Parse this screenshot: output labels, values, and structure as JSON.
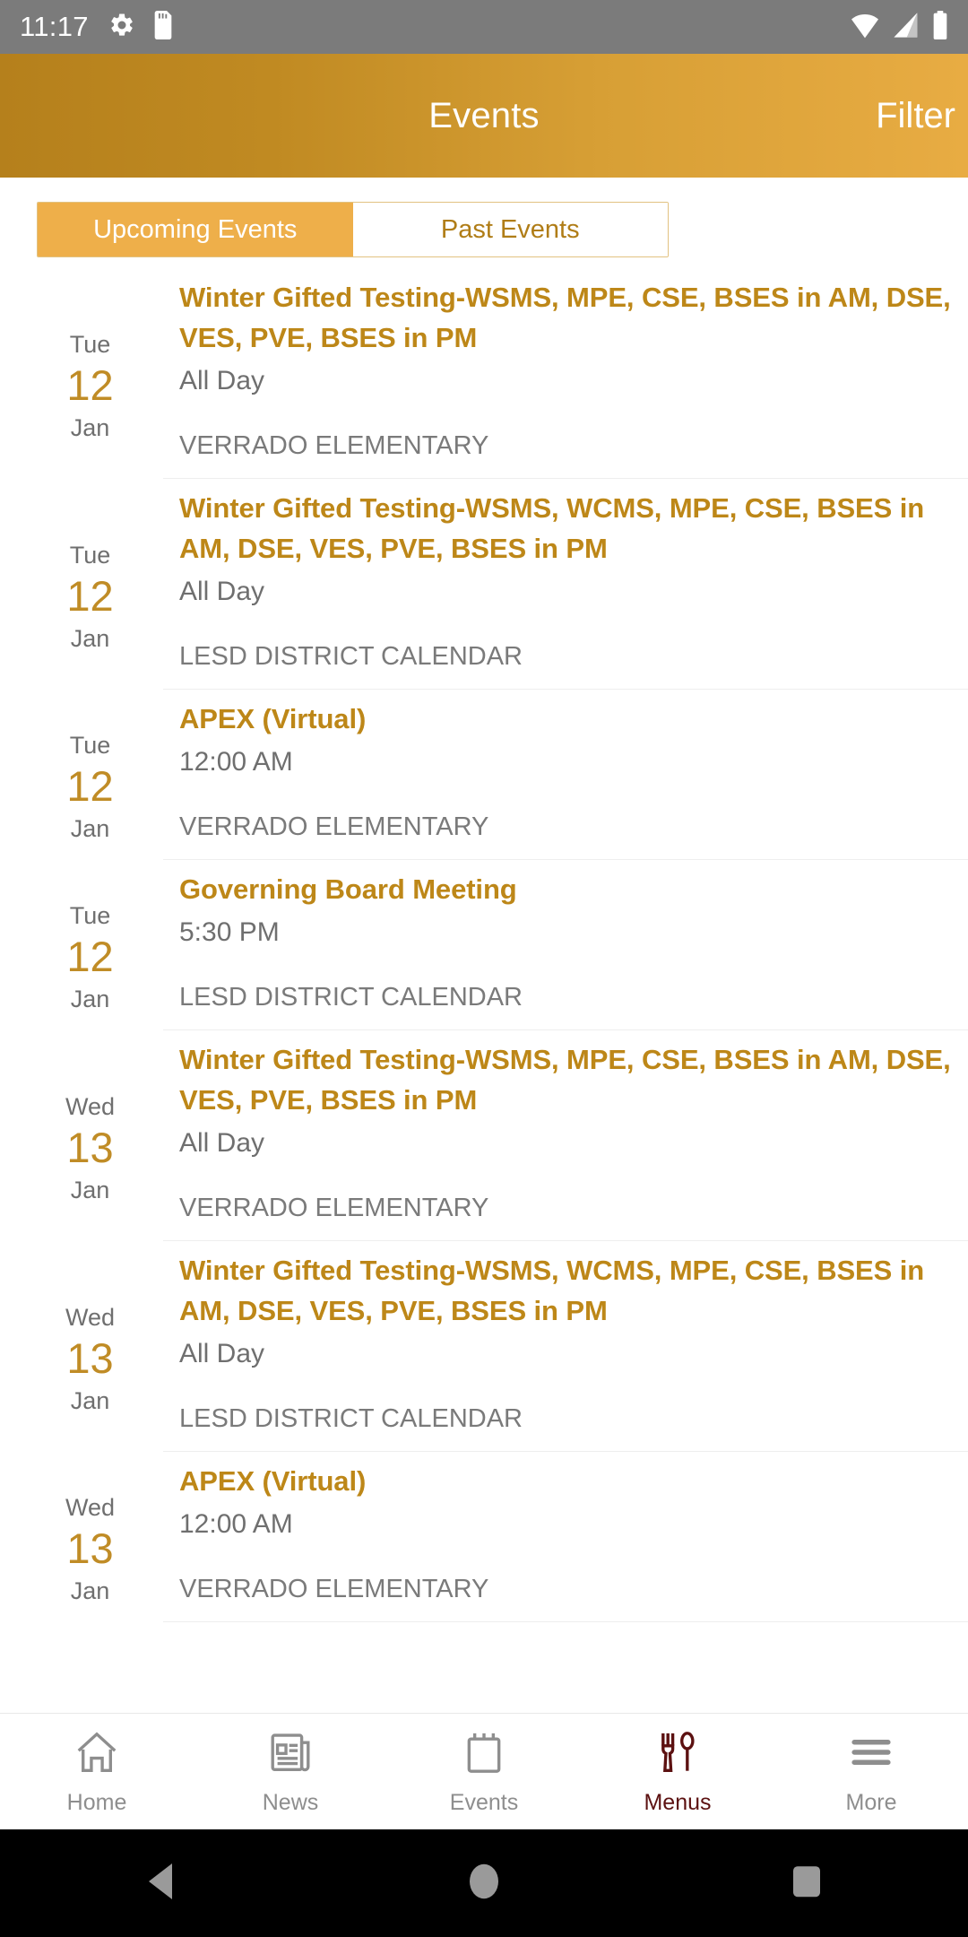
{
  "status_bar": {
    "time": "11:17",
    "icons": [
      "settings-gear-icon",
      "sd-card-icon",
      "wifi-icon",
      "cellular-signal-icon",
      "battery-icon"
    ]
  },
  "app_bar": {
    "title": "Events",
    "action_label": "Filter",
    "gradient_from": "#b5801c",
    "gradient_to": "#e8ac43"
  },
  "tabs": {
    "items": [
      {
        "label": "Upcoming Events",
        "active": true
      },
      {
        "label": "Past Events",
        "active": false
      }
    ],
    "active_bg": "#eeaf4a",
    "inactive_text": "#b07d17"
  },
  "events": [
    {
      "dow": "Tue",
      "day": "12",
      "mon": "Jan",
      "title": "Winter Gifted Testing-WSMS, MPE, CSE, BSES in AM, DSE, VES, PVE, BSES in PM",
      "time": "All Day",
      "location": "VERRADO ELEMENTARY",
      "accent": "#2d4cdb"
    },
    {
      "dow": "Tue",
      "day": "12",
      "mon": "Jan",
      "title": "Winter Gifted Testing-WSMS, WCMS, MPE, CSE, BSES in AM, DSE, VES, PVE, BSES in PM",
      "time": "All Day",
      "location": "LESD DISTRICT CALENDAR",
      "accent": "#3d0a0a"
    },
    {
      "dow": "Tue",
      "day": "12",
      "mon": "Jan",
      "title": "APEX (Virtual)",
      "time": "12:00 AM",
      "location": "VERRADO ELEMENTARY",
      "accent": "#2d4cdb"
    },
    {
      "dow": "Tue",
      "day": "12",
      "mon": "Jan",
      "title": "Governing Board Meeting",
      "time": "5:30 PM",
      "location": "LESD DISTRICT CALENDAR",
      "accent": "#3d0a0a"
    },
    {
      "dow": "Wed",
      "day": "13",
      "mon": "Jan",
      "title": "Winter Gifted Testing-WSMS, MPE, CSE, BSES in AM, DSE, VES, PVE, BSES in PM",
      "time": "All Day",
      "location": "VERRADO ELEMENTARY",
      "accent": "#2d4cdb"
    },
    {
      "dow": "Wed",
      "day": "13",
      "mon": "Jan",
      "title": "Winter Gifted Testing-WSMS, WCMS, MPE, CSE, BSES in AM, DSE, VES, PVE, BSES in PM",
      "time": "All Day",
      "location": "LESD DISTRICT CALENDAR",
      "accent": "#3d0a0a"
    },
    {
      "dow": "Wed",
      "day": "13",
      "mon": "Jan",
      "title": "APEX (Virtual)",
      "time": "12:00 AM",
      "location": "VERRADO ELEMENTARY",
      "accent": "#2d4cdb"
    }
  ],
  "bottom_nav": {
    "items": [
      {
        "label": "Home",
        "icon": "home-icon",
        "active": false
      },
      {
        "label": "News",
        "icon": "news-icon",
        "active": false
      },
      {
        "label": "Events",
        "icon": "calendar-icon",
        "active": false
      },
      {
        "label": "Menus",
        "icon": "cutlery-icon",
        "active": true
      },
      {
        "label": "More",
        "icon": "hamburger-icon",
        "active": false
      }
    ],
    "active_color": "#5c1111",
    "inactive_color": "#8e8e8e"
  },
  "system_nav": {
    "buttons": [
      "back-triangle-icon",
      "home-circle-icon",
      "recents-square-icon"
    ]
  }
}
